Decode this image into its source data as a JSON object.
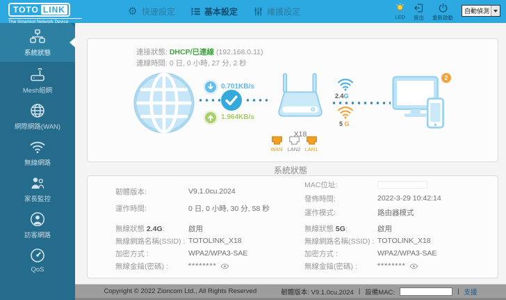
{
  "colors": {
    "header_blue": "#2BA9E0",
    "sidebar_teal": "#256C8C",
    "sidebar_active": "#2E80A2",
    "status_green": "#3FA142",
    "accent_orange": "#F2A33C",
    "download_blue": "#5FB9E8",
    "upload_green": "#A5CC62"
  },
  "header": {
    "logo_brand_left": "TOTO",
    "logo_brand_right": "LINK",
    "logo_tagline": "The Smartest Network Device",
    "tabs": [
      {
        "label": "快速設定",
        "icon": "gear-icon"
      },
      {
        "label": "基本設定",
        "icon": "list-icon"
      },
      {
        "label": "維護設定",
        "icon": "sliders-icon"
      }
    ],
    "led_label": "LED",
    "logout_label": "登出",
    "restart_label": "重新啟動",
    "language_select_value": "自動偵測"
  },
  "sidebar": {
    "items": [
      {
        "label": "系統狀態",
        "icon": "topology-icon",
        "active": true
      },
      {
        "label": "Mesh組網",
        "icon": "mesh-router-icon",
        "active": false
      },
      {
        "label": "網際網路(WAN)",
        "icon": "globe-icon",
        "active": false
      },
      {
        "label": "無線網路",
        "icon": "wifi-icon",
        "active": false
      },
      {
        "label": "家長監控",
        "icon": "parental-control-icon",
        "active": false
      },
      {
        "label": "訪客網路",
        "icon": "guest-network-icon",
        "active": false
      },
      {
        "label": "QoS",
        "icon": "speedometer-icon",
        "active": false
      }
    ]
  },
  "connection": {
    "status_label": "連接狀態:",
    "status_value": "DHCP/已連線",
    "ip": "(192.168.0.11)",
    "uptime_label": "連線時間:",
    "uptime_value": "0 日, 0 小時, 27 分, 2 秒",
    "download_speed": "0.701KB/s",
    "upload_speed": "1.964KB/s",
    "router_model": "X18",
    "band24_num": "2.4",
    "band24_unit": "G",
    "band5_num": "5",
    "band5_unit": "G",
    "client_count": "2",
    "ports": [
      {
        "label": "WAN",
        "state": "connected"
      },
      {
        "label": "LAN2",
        "state": "empty"
      },
      {
        "label": "LAN1",
        "state": "connected"
      }
    ]
  },
  "system": {
    "title": "系統狀態",
    "firmware_label": "韌體版本:",
    "firmware_value": "V9.1.0cu.2024",
    "uptime_label": "運作時間:",
    "uptime_value": "0 日, 0 小時, 30 分, 58 秒",
    "mac_label": "MAC位址:",
    "release_label": "發佈時間:",
    "release_value": "2022-3-29 10:42:14",
    "mode_label": "運作模式:",
    "mode_value": "路由器模式",
    "wireless": [
      {
        "status_label": "無線狀態 ",
        "band": "2.4G",
        "colon": ":",
        "status_value": "啟用",
        "ssid_label": "無線網路名稱(SSID) :",
        "ssid_value": "TOTOLINK_X18",
        "security_label": "加密方式 :",
        "security_value": "WPA2/WPA3-SAE",
        "key_label": "無線金鑰(密碼) :",
        "key_value": "********"
      },
      {
        "status_label": "無線狀態 ",
        "band": "5G",
        "colon": ":",
        "status_value": "啟用",
        "ssid_label": "無線網路名稱(SSID) :",
        "ssid_value": "TOTOLINK_X18",
        "security_label": "加密方式 :",
        "security_value": "WPA2/WPA3-SAE",
        "key_label": "無線金鑰(密碼) :",
        "key_value": "********"
      }
    ]
  },
  "footer": {
    "copyright": "Copyright © 2022 Zioncom Ltd., All Rights Reserved",
    "firmware_text": "韌體版本: V9.1.0cu.2024",
    "separator": "|",
    "mac_label": "設備MAC:",
    "support": "支援"
  }
}
